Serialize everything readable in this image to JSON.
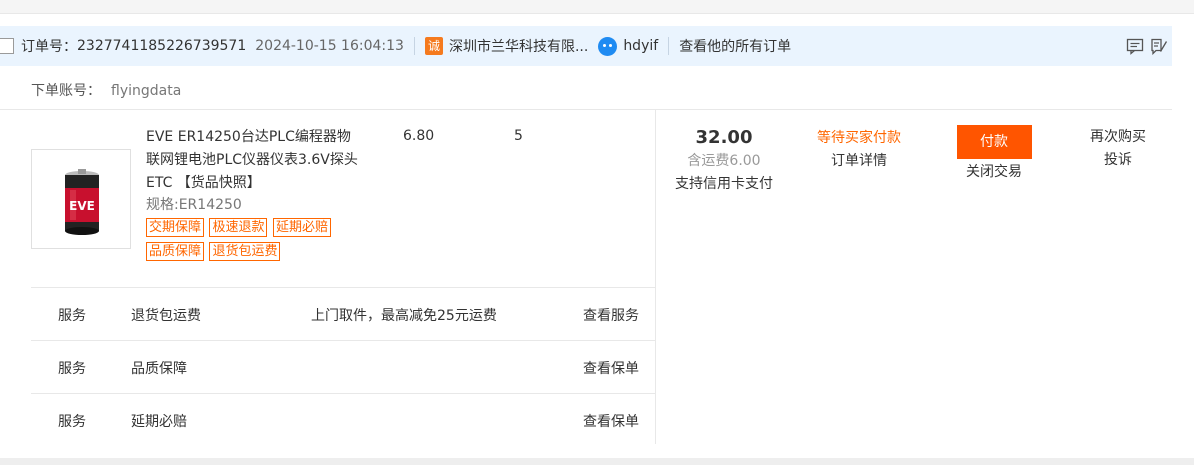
{
  "header": {
    "order_label": "订单号：",
    "order_no": "2327741185226739571",
    "order_time": "2024-10-15 16:04:13",
    "shop_icon_text": "诚",
    "shop_name": "深圳市兰华科技有限...",
    "buyer": "hdyif",
    "all_orders": "查看他的所有订单"
  },
  "account": {
    "label": "下单账号：",
    "value": "flyingdata"
  },
  "item": {
    "title": "EVE ER14250台达PLC编程器物联网锂电池PLC仪器仪表3.6V探头ETC",
    "snapshot": "【货品快照】",
    "spec": "规格:ER14250",
    "tags": [
      "交期保障",
      "极速退款",
      "延期必赔",
      "品质保障",
      "退货包运费"
    ],
    "unit_price": "6.80",
    "quantity": "5",
    "image_text": "EVE"
  },
  "total": {
    "amount": "32.00",
    "shipping": "含运费6.00",
    "credit": "支持信用卡支付"
  },
  "status": {
    "waiting": "等待买家付款",
    "detail": "订单详情"
  },
  "actions": {
    "pay": "付款",
    "close": "关闭交易",
    "rebuy": "再次购买",
    "complain": "投诉"
  },
  "services": [
    {
      "type": "服务",
      "name": "退货包运费",
      "desc": "上门取件，最高减免25元运费",
      "link": "查看服务"
    },
    {
      "type": "服务",
      "name": "品质保障",
      "desc": "",
      "link": "查看保单"
    },
    {
      "type": "服务",
      "name": "延期必赔",
      "desc": "",
      "link": "查看保单"
    }
  ],
  "colors": {
    "accent": "#ff5500",
    "header_bg": "#eaf4fe",
    "tag": "#ff6600"
  }
}
